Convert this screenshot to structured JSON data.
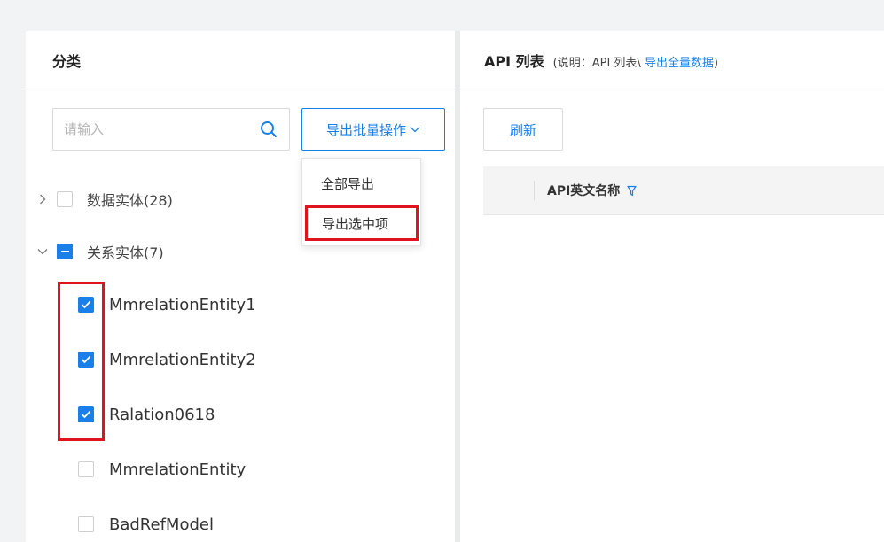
{
  "left_panel": {
    "title": "分类",
    "search": {
      "placeholder": "请输入",
      "value": ""
    },
    "batch_button_label": "导出批量操作",
    "dropdown": {
      "items": [
        "全部导出",
        "导出选中项"
      ]
    },
    "tree": {
      "groups": [
        {
          "label": "数据实体(28)",
          "expanded": false,
          "checked": "none"
        },
        {
          "label": "关系实体(7)",
          "expanded": true,
          "checked": "partial"
        }
      ],
      "children": [
        {
          "label": "MmrelationEntity1",
          "checked": true
        },
        {
          "label": "MmrelationEntity2",
          "checked": true
        },
        {
          "label": "Ralation0618",
          "checked": true
        },
        {
          "label": "MmrelationEntity",
          "checked": false
        },
        {
          "label": "BadRefModel",
          "checked": false
        }
      ]
    }
  },
  "right_panel": {
    "title": "API 列表",
    "desc_prefix": "(说明：API 列表\\ ",
    "desc_link": "导出全量数据",
    "desc_suffix": ")",
    "refresh_label": "刷新",
    "table": {
      "columns": [
        "API英文名称"
      ]
    }
  },
  "colors": {
    "accent": "#1a7fe8",
    "highlight": "#e0141e",
    "background": "#f2f3f5"
  }
}
